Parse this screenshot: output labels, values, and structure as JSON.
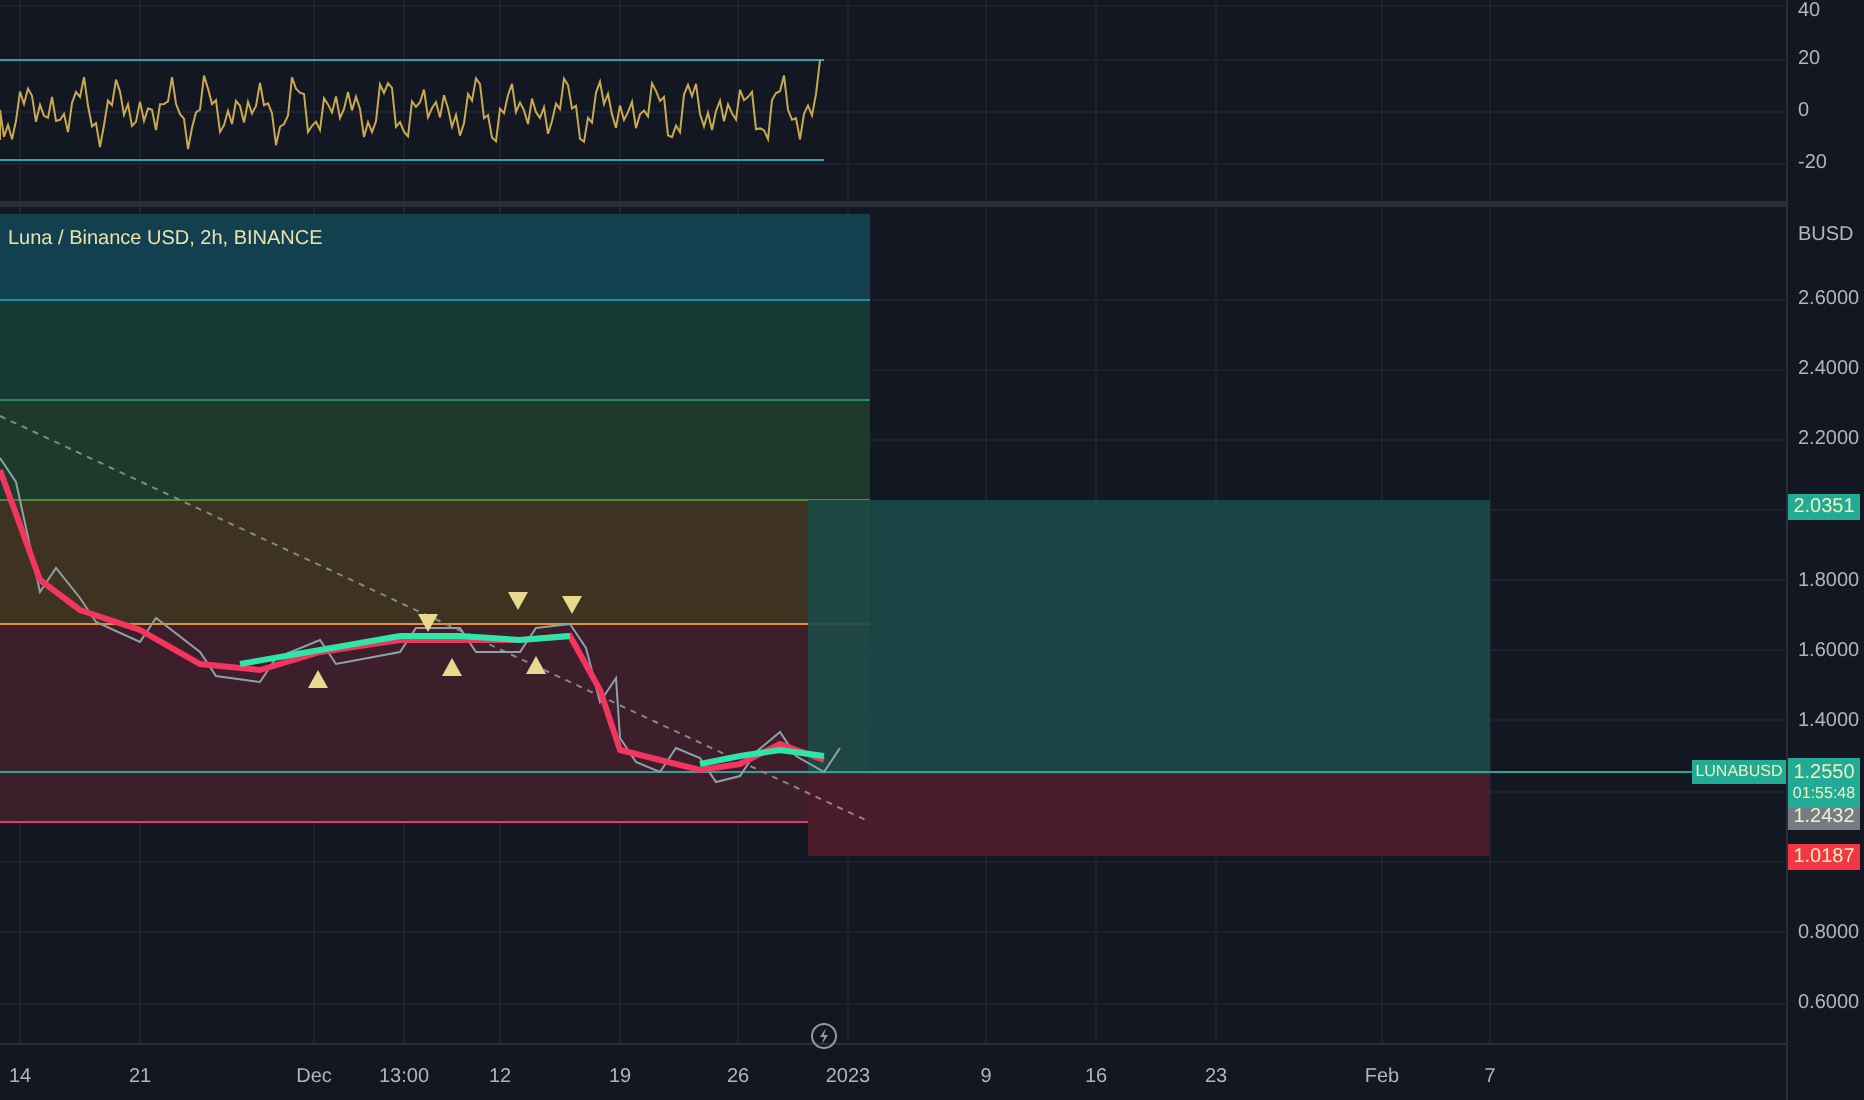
{
  "oscillator": {
    "axis_labels": [
      "40",
      "20",
      "0",
      "-20"
    ]
  },
  "main": {
    "legend": "Luna / Binance USD, 2h, BINANCE",
    "currency": "BUSD",
    "axis_labels": [
      "2.6000",
      "2.4000",
      "2.2000",
      "1.8000",
      "1.6000",
      "1.4000",
      "0.8000",
      "0.6000"
    ],
    "price_tags": [
      {
        "kind": "target",
        "value": "2.0351"
      },
      {
        "kind": "entry",
        "value": "1.2432"
      },
      {
        "kind": "stop",
        "value": "1.0187"
      }
    ],
    "symbol_tag": {
      "symbol": "LUNABUSD",
      "price": "1.2550",
      "countdown": "01:55:48"
    }
  },
  "time_axis": {
    "labels": [
      "14",
      "21",
      "Dec",
      "13:00",
      "12",
      "19",
      "26",
      "2023",
      "9",
      "16",
      "23",
      "Feb",
      "7"
    ]
  }
}
